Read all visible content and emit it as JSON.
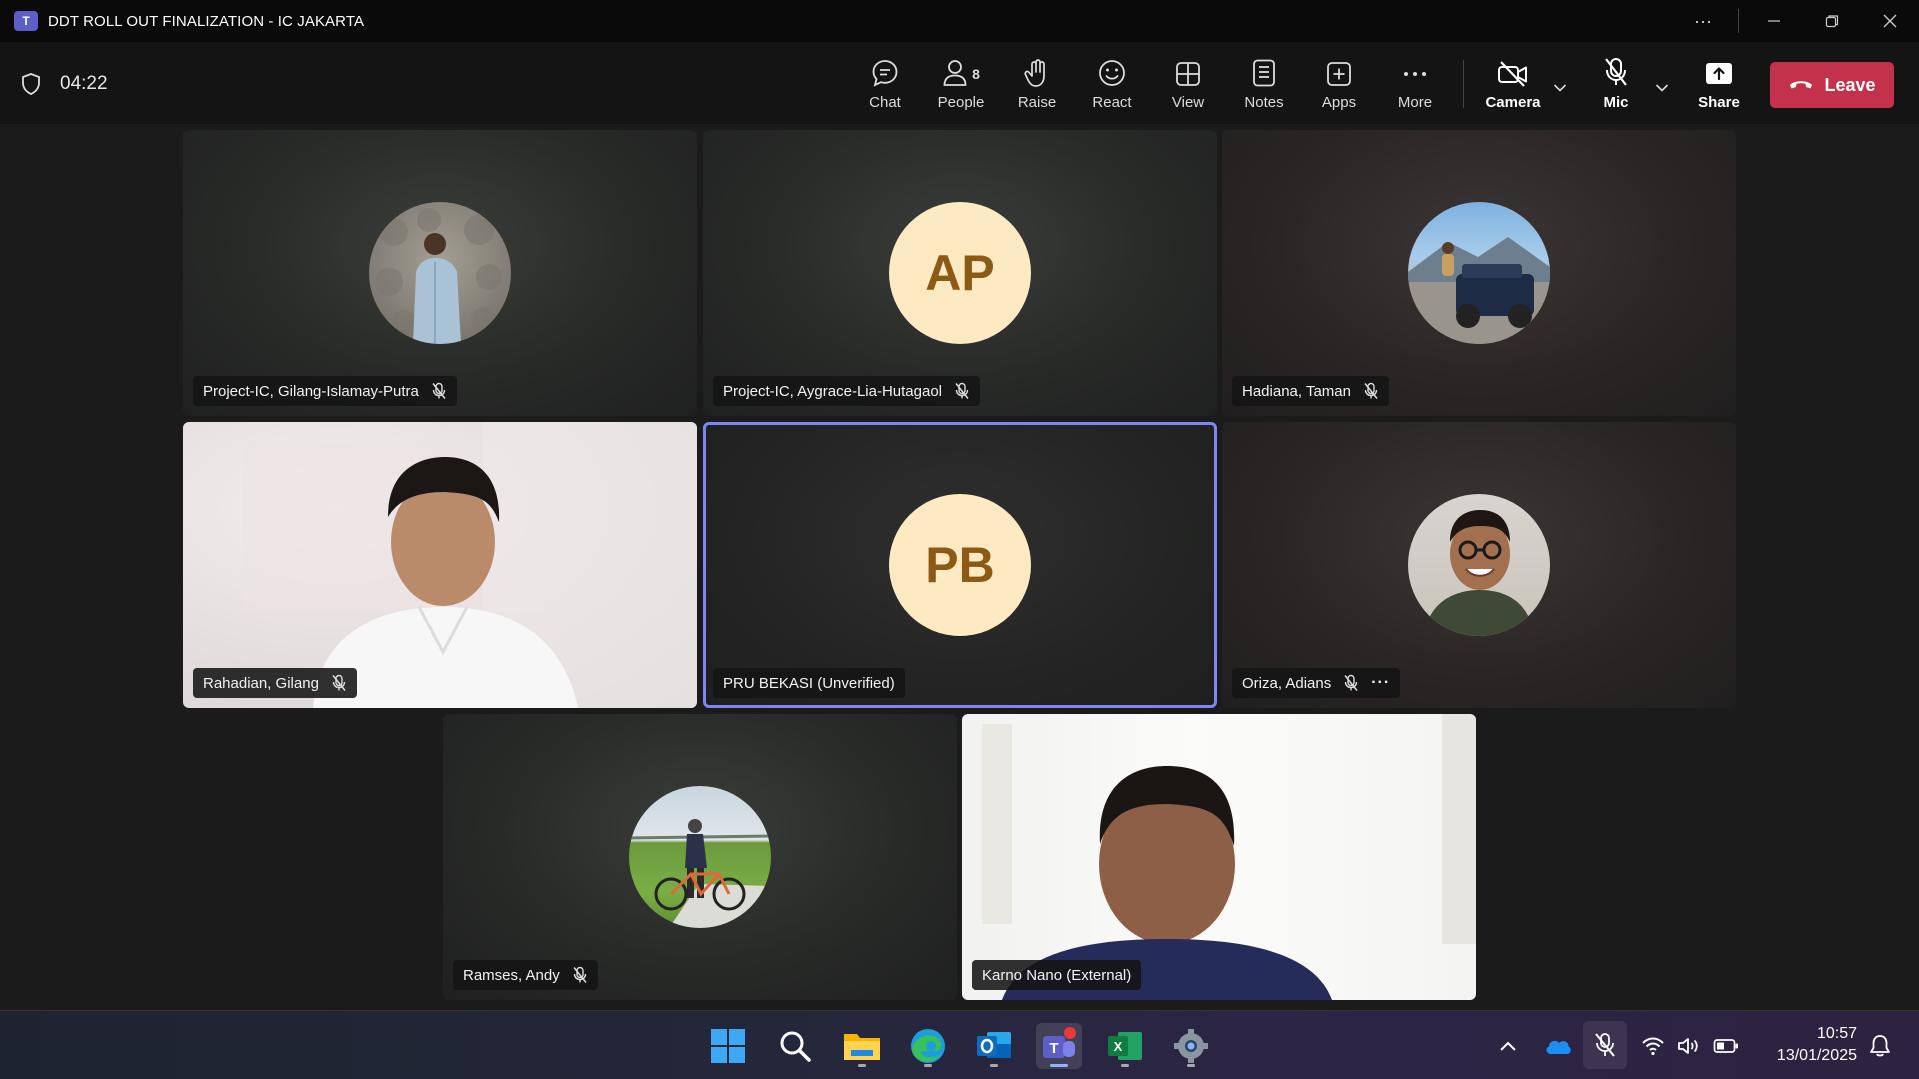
{
  "window": {
    "title": "DDT ROLL OUT FINALIZATION - IC JAKARTA",
    "logo_letter": "T"
  },
  "meeting": {
    "timer": "04:22"
  },
  "toolbar": {
    "chat": "Chat",
    "people": "People",
    "people_count": "8",
    "raise": "Raise",
    "react": "React",
    "view": "View",
    "notes": "Notes",
    "apps": "Apps",
    "more": "More",
    "camera": "Camera",
    "mic": "Mic",
    "share": "Share",
    "leave": "Leave"
  },
  "participants": [
    {
      "name": "Project-IC, Gilang-Islamay-Putra",
      "muted": true,
      "display": "photo"
    },
    {
      "name": "Project-IC, Aygrace-Lia-Hutagaol",
      "muted": true,
      "display": "initials",
      "initials": "AP"
    },
    {
      "name": "Hadiana, Taman",
      "muted": true,
      "display": "photo"
    },
    {
      "name": "Rahadian, Gilang",
      "muted": true,
      "display": "video"
    },
    {
      "name": "PRU BEKASI (Unverified)",
      "muted": false,
      "display": "initials",
      "initials": "PB",
      "active_speaker": true
    },
    {
      "name": "Oriza, Adians",
      "muted": true,
      "display": "photo",
      "has_more": true
    },
    {
      "name": "Ramses, Andy",
      "muted": true,
      "display": "photo"
    },
    {
      "name": "Karno Nano (External)",
      "muted": false,
      "display": "video"
    }
  ],
  "colors": {
    "accent": "#7f85f5",
    "leave": "#c4314b",
    "initials_bg": "#fdeac2",
    "initials_fg": "#8a5a16"
  },
  "taskbar": {
    "apps": [
      "windows-start",
      "search",
      "file-explorer",
      "edge",
      "outlook",
      "teams",
      "excel",
      "settings"
    ],
    "time": "10:57",
    "date": "13/01/2025"
  }
}
